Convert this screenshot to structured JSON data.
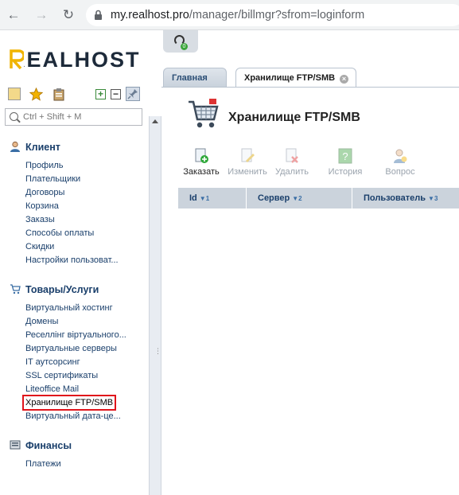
{
  "browser": {
    "url_host": "my.realhost.pro",
    "url_path": "/manager/billmgr?sfrom=loginform"
  },
  "brand": {
    "logo_text": "REALHOST"
  },
  "sidebar": {
    "search_placeholder": "Ctrl + Shift + M",
    "sections": [
      {
        "title": "Клиент",
        "items": [
          "Профиль",
          "Плательщики",
          "Договоры",
          "Корзина",
          "Заказы",
          "Способы оплаты",
          "Скидки",
          "Настройки пользоват..."
        ]
      },
      {
        "title": "Товары/Услуги",
        "items": [
          "Виртуальный хостинг",
          "Домены",
          "Реселлінг віртуального...",
          "Виртуальные серверы",
          "IT аутсорсинг",
          "SSL сертификаты",
          "Liteoffice Mail",
          "Хранилище FTP/SMB",
          "Виртуальный дата-це..."
        ],
        "active_item": "Хранилище FTP/SMB"
      },
      {
        "title": "Финансы",
        "items": [
          "Платежи"
        ]
      }
    ]
  },
  "support": {
    "badge": "0"
  },
  "tabs": [
    {
      "label": "Главная",
      "active": false
    },
    {
      "label": "Хранилище FTP/SMB",
      "active": true
    }
  ],
  "page": {
    "title": "Хранилище FTP/SMB",
    "toolbar": [
      {
        "label": "Заказать",
        "enabled": true,
        "icon": "add-document-icon"
      },
      {
        "label": "Изменить",
        "enabled": false,
        "icon": "edit-document-icon"
      },
      {
        "label": "Удалить",
        "enabled": false,
        "icon": "delete-document-icon"
      },
      {
        "label": "История",
        "enabled": false,
        "icon": "history-icon"
      },
      {
        "label": "Вопрос",
        "enabled": false,
        "icon": "question-user-icon"
      }
    ],
    "columns": [
      {
        "label": "Id",
        "sort": "1"
      },
      {
        "label": "Сервер",
        "sort": "2"
      },
      {
        "label": "Пользователь",
        "sort": "3"
      }
    ]
  },
  "colors": {
    "accent": "#1a3f6b",
    "highlight": "#e0141b",
    "grid_header": "#cbd3dc"
  }
}
